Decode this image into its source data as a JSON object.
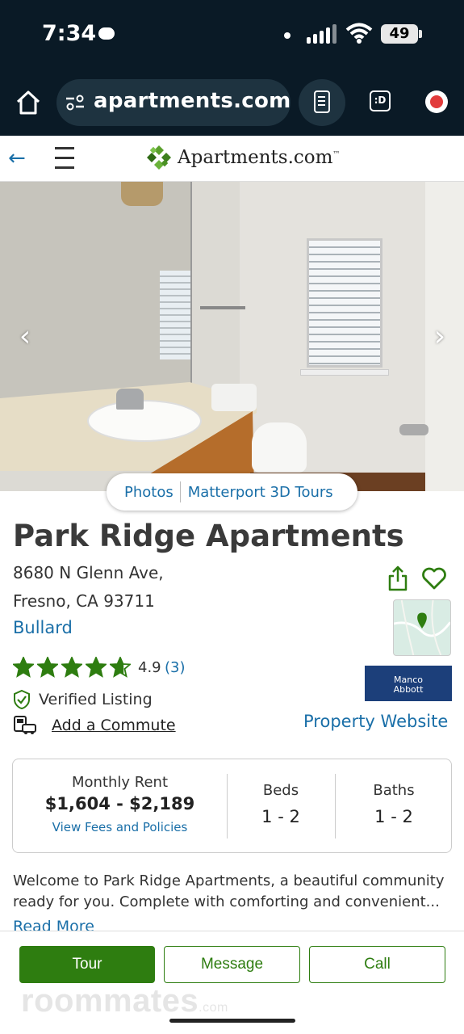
{
  "status_bar": {
    "time": "7:34",
    "battery": "49"
  },
  "browser": {
    "url": "apartments.com/",
    "ext_label": ":D"
  },
  "site": {
    "brand": "Apartments.com",
    "trademark": "™"
  },
  "gallery": {
    "tabs": [
      "Photos",
      "Matterport 3D Tours"
    ]
  },
  "listing": {
    "name": "Park Ridge Apartments",
    "address_line1": "8680 N Glenn Ave,",
    "address_line2": "Fresno, CA 93711",
    "neighborhood": "Bullard",
    "rating": "4.9",
    "rating_score": 4.9,
    "review_count": "(3)",
    "verified_label": "Verified Listing",
    "commute_label": "Add a Commute",
    "property_website_label": "Property Website",
    "manager_logo_text": [
      "Manco",
      "Abbott"
    ]
  },
  "pricing": {
    "rent_label": "Monthly Rent",
    "rent_value": "$1,604 - $2,189",
    "fees_link": "View Fees and Policies",
    "beds_label": "Beds",
    "beds_value": "1 - 2",
    "baths_label": "Baths",
    "baths_value": "1 - 2"
  },
  "description": {
    "line1": "Welcome to Park Ridge Apartments, a beautiful community",
    "line2": "ready for you. Complete with comforting and convenient...",
    "read_more": "Read More"
  },
  "actions": {
    "tour": "Tour",
    "message": "Message",
    "call": "Call"
  },
  "watermark": {
    "main": "roommates",
    "suffix": ".com"
  },
  "colors": {
    "brand_green": "#2e7d10",
    "link_blue": "#1a6fa8",
    "browser_dark": "#0a1a26"
  }
}
